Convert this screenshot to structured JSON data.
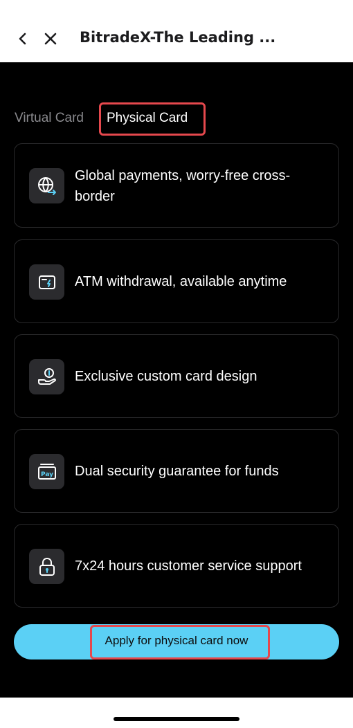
{
  "header": {
    "title": "BitradeX-The Leading ...",
    "back_icon": "chevron-left-icon",
    "close_icon": "close-icon"
  },
  "tabs": [
    {
      "label": "Virtual Card",
      "selected": false
    },
    {
      "label": "Physical Card",
      "selected": true
    }
  ],
  "features": [
    {
      "icon": "globe-transfer-icon",
      "text": "Global payments, worry-free cross-border"
    },
    {
      "icon": "card-lightning-icon",
      "text": "ATM withdrawal, available anytime"
    },
    {
      "icon": "hand-coin-icon",
      "text": "Exclusive custom card design"
    },
    {
      "icon": "pay-card-icon",
      "text": "Dual security guarantee for funds"
    },
    {
      "icon": "lock-icon",
      "text": "7x24 hours customer service support"
    }
  ],
  "cta": {
    "label": "Apply for physical card now"
  },
  "colors": {
    "accent": "#5bd0f5",
    "background": "#000000",
    "highlight": "#e5484d"
  }
}
